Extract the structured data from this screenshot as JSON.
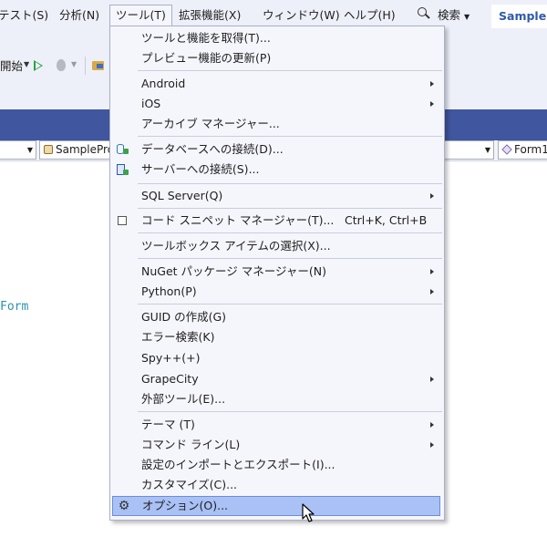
{
  "menubar": {
    "items": [
      {
        "label": "テスト(S)"
      },
      {
        "label": "分析(N)"
      },
      {
        "label": "ツール(T)"
      },
      {
        "label": "拡張機能(X)"
      },
      {
        "label": "ウィンドウ(W)"
      },
      {
        "label": "ヘルプ(H)"
      }
    ],
    "search_label": "検索",
    "solution_name": "SampleProject"
  },
  "toolbar": {
    "start_label": "開始"
  },
  "navbar": {
    "project_combo": "SampleProject",
    "class_combo": "Form1"
  },
  "editor": {
    "visible_code": "Form"
  },
  "tools_menu": {
    "items": [
      {
        "label": "ツールと機能を取得(T)..."
      },
      {
        "label": "プレビュー機能の更新(P)"
      },
      {
        "label": "Android"
      },
      {
        "label": "iOS"
      },
      {
        "label": "アーカイブ マネージャー..."
      },
      {
        "label": "データベースへの接続(D)..."
      },
      {
        "label": "サーバーへの接続(S)..."
      },
      {
        "label": "SQL Server(Q)"
      },
      {
        "label": "コード スニペット マネージャー(T)...",
        "shortcut": "Ctrl+K, Ctrl+B"
      },
      {
        "label": "ツールボックス アイテムの選択(X)..."
      },
      {
        "label": "NuGet パッケージ マネージャー(N)"
      },
      {
        "label": "Python(P)"
      },
      {
        "label": "GUID の作成(G)"
      },
      {
        "label": "エラー検索(K)"
      },
      {
        "label": "Spy++(+)"
      },
      {
        "label": "GrapeCity"
      },
      {
        "label": "外部ツール(E)..."
      },
      {
        "label": "テーマ (T)"
      },
      {
        "label": "コマンド ライン(L)"
      },
      {
        "label": "設定のインポートとエクスポート(I)..."
      },
      {
        "label": "カスタマイズ(C)..."
      },
      {
        "label": "オプション(O)..."
      }
    ]
  },
  "colors": {
    "menu_background": "#f5f6fc",
    "highlight": "#a9c1f5",
    "tab_strip": "#40569e",
    "chrome": "#eef0f9"
  }
}
